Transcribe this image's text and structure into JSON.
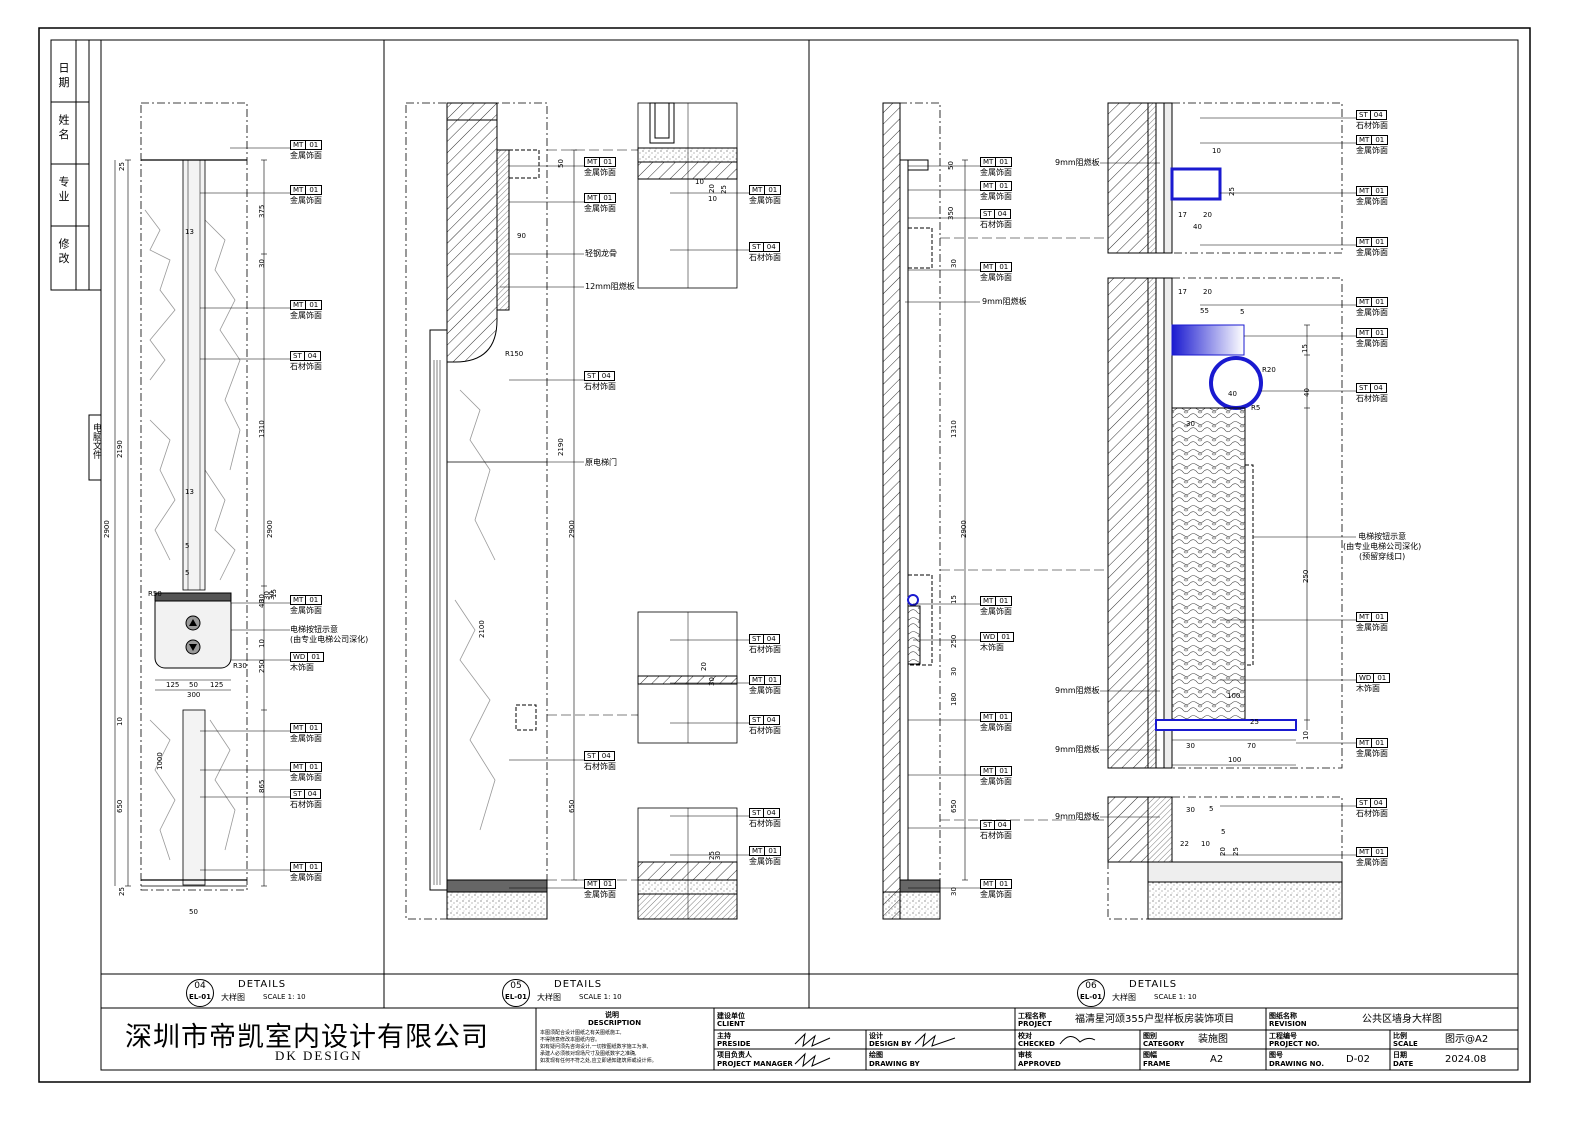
{
  "company": {
    "name_cn": "深圳市帝凯室内设计有限公司",
    "name_en": "DK DESIGN"
  },
  "revision_col": {
    "labels": [
      "日 期",
      "姓 名",
      "专 业",
      "修 改"
    ],
    "file_label": "电脑文件"
  },
  "materials": {
    "mt": {
      "code": "MT",
      "num": "01",
      "name": "金属饰面"
    },
    "st": {
      "code": "ST",
      "num": "04",
      "name": "石材饰面"
    },
    "wd": {
      "code": "WD",
      "num": "01",
      "name": "木饰面"
    }
  },
  "callouts": {
    "button": [
      "电梯按钮示意",
      "(由专业电梯公司深化)"
    ],
    "button2": [
      "电梯按钮示意",
      "(由专业电梯公司深化)",
      "(预留穿线口)"
    ],
    "steel": "轻钢龙骨",
    "board12": "12mm阻燃板",
    "board9": "9mm阻燃板",
    "door": "原电梯门"
  },
  "details": [
    {
      "num": "04",
      "ref": "EL-01",
      "label": "DETAILS",
      "sub": "大样图",
      "scale": "SCALE 1: 10"
    },
    {
      "num": "05",
      "ref": "EL-01",
      "label": "DETAILS",
      "sub": "大样图",
      "scale": "SCALE 1: 10"
    },
    {
      "num": "06",
      "ref": "EL-01",
      "label": "DETAILS",
      "sub": "大样图",
      "scale": "SCALE 1: 10"
    }
  ],
  "dims": {
    "d04": [
      "25",
      "375",
      "30",
      "1310",
      "2190",
      "2900",
      "2900",
      "30",
      "30",
      "30",
      "15",
      "40",
      "10",
      "250",
      "30",
      "125",
      "50",
      "125",
      "300",
      "10",
      "1000",
      "865",
      "650",
      "25",
      "50",
      "R50",
      "R30",
      "13",
      "13",
      "5",
      "5"
    ],
    "d05": [
      "50",
      "90",
      "R150",
      "2190",
      "2900",
      "2100",
      "650",
      "10",
      "20",
      "25",
      "10",
      "30",
      "20",
      "25",
      "30"
    ],
    "d06": [
      "50",
      "350",
      "30",
      "1310",
      "2900",
      "15",
      "250",
      "30",
      "180",
      "650",
      "30",
      "10",
      "25",
      "17",
      "20",
      "40",
      "17",
      "20",
      "55",
      "5",
      "15",
      "R20",
      "40",
      "R5",
      "40",
      "30",
      "250",
      "100",
      "30",
      "70",
      "100",
      "10",
      "25",
      "30",
      "5",
      "22",
      "10",
      "20",
      "25",
      "5"
    ]
  },
  "titleblock": {
    "description": {
      "cn": "说明",
      "en": "DESCRIPTION",
      "lines": [
        "本图须配合设计图纸之有关图纸施工,",
        "不得随意修改本图纸内容。",
        "如有疑问须先咨询设计,一切按图纸数字施工为准,",
        "承建人必须核对现场尺寸及图纸数字之准确,",
        "如发现有任何不符之处,应立即通知建筑师或设计师。"
      ]
    },
    "client": {
      "cn": "建设单位",
      "en": "CLIENT"
    },
    "preside": {
      "cn": "主持",
      "en": "PRESIDE"
    },
    "design": {
      "cn": "设计",
      "en": "DESIGN BY"
    },
    "pm": {
      "cn": "项目负责人",
      "en": "PROJECT MANAGER"
    },
    "drawing_by": {
      "cn": "绘图",
      "en": "DRAWING BY"
    },
    "project": {
      "cn": "工程名称",
      "en": "PROJECT",
      "value": "福清星河颂355户型样板房装饰项目"
    },
    "checked": {
      "cn": "校对",
      "en": "CHECKED"
    },
    "approved": {
      "cn": "审核",
      "en": "APPROVED"
    },
    "category": {
      "cn": "图别",
      "en": "CATEGORY",
      "value": "装施图"
    },
    "frame": {
      "cn": "图幅",
      "en": "FRAME",
      "value": "A2"
    },
    "revision": {
      "cn": "图纸名称",
      "en": "REVISION",
      "value": "公共区墙身大样图"
    },
    "project_no": {
      "cn": "工程编号",
      "en": "PROJECT NO.",
      "value": ""
    },
    "drawing_no": {
      "cn": "图号",
      "en": "DRAWING NO.",
      "value": "D-02"
    },
    "scale": {
      "cn": "比例",
      "en": "SCALE",
      "value": "图示@A2"
    },
    "date": {
      "cn": "日期",
      "en": "DATE",
      "value": "2024.08"
    }
  }
}
